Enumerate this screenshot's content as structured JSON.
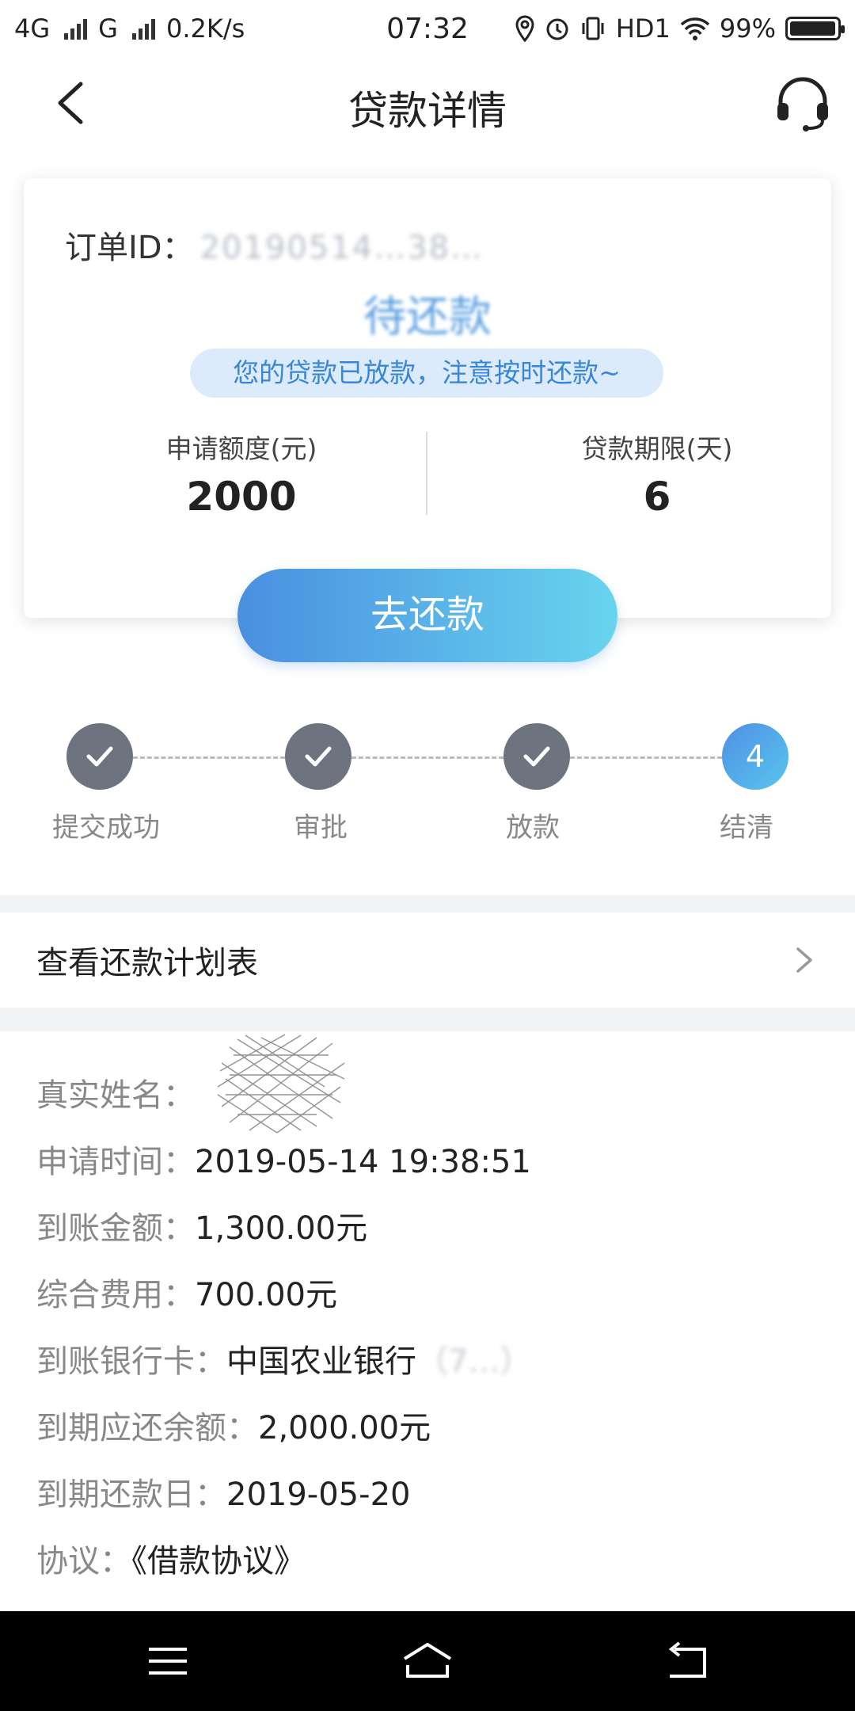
{
  "status_bar": {
    "network1": "4G",
    "network2": "G",
    "speed": "0.2K/s",
    "time": "07:32",
    "hd": "HD1",
    "battery": "99%",
    "battery_level": 0.99
  },
  "header": {
    "title": "贷款详情"
  },
  "card": {
    "order_label": "订单ID：",
    "order_value": "20190514…38…",
    "status": "待还款",
    "notice": "您的贷款已放款，注意按时还款~",
    "amount_label": "申请额度(元)",
    "amount_value": "2000",
    "term_label": "贷款期限(天)",
    "term_value": "6",
    "repay_button": "去还款"
  },
  "steps": [
    {
      "label": "提交成功",
      "done": true
    },
    {
      "label": "审批",
      "done": true
    },
    {
      "label": "放款",
      "done": true
    },
    {
      "label": "结清",
      "done": false,
      "number": "4"
    }
  ],
  "schedule": {
    "label": "查看还款计划表"
  },
  "details": {
    "name_label": "真实姓名：",
    "apply_time_label": "申请时间：",
    "apply_time_value": "2019-05-14 19:38:51",
    "arrival_amount_label": "到账金额：",
    "arrival_amount_value": "1,300.00元",
    "fee_label": "综合费用：",
    "fee_value": "700.00元",
    "bank_label": "到账银行卡：",
    "bank_value": "中国农业银行",
    "bank_suffix": "（7…）",
    "due_amount_label": "到期应还余额：",
    "due_amount_value": "2,000.00元",
    "due_date_label": "到期还款日：",
    "due_date_value": "2019-05-20",
    "agreement_label": "协议：",
    "agreement_value": "《借款协议》"
  },
  "colors": {
    "accent": "#4a8fe0",
    "accent_light": "#68d4ee",
    "step_done": "#6d7480"
  }
}
